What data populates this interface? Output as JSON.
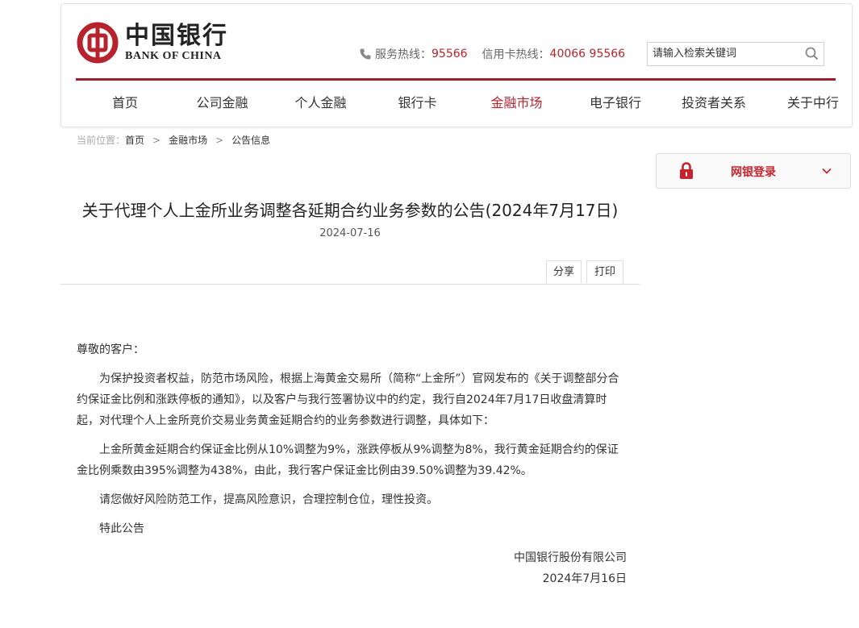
{
  "header": {
    "logo_cn": "中国银行",
    "logo_en": "BANK OF CHINA",
    "service_label": "服务热线：",
    "service_number": "95566",
    "card_label": "信用卡热线：",
    "card_number": "40066 95566",
    "search_placeholder": "请输入检索关键词"
  },
  "nav": {
    "items": [
      {
        "label": "首页"
      },
      {
        "label": "公司金融"
      },
      {
        "label": "个人金融"
      },
      {
        "label": "银行卡"
      },
      {
        "label": "金融市场"
      },
      {
        "label": "电子银行"
      },
      {
        "label": "投资者关系"
      },
      {
        "label": "关于中行"
      }
    ],
    "active": "金融市场"
  },
  "breadcrumb": {
    "lead": "当前位置：",
    "items": [
      "首页",
      "金融市场",
      "公告信息"
    ]
  },
  "login": {
    "label": "网银登录"
  },
  "article": {
    "title": "关于代理个人上金所业务调整各延期合约业务参数的公告(2024年7月17日)",
    "date": "2024-07-16",
    "share_label": "分享",
    "print_label": "打印",
    "greeting": "尊敬的客户：",
    "paragraphs": [
      "为保护投资者权益，防范市场风险，根据上海黄金交易所（简称“上金所”）官网发布的《关于调整部分合约保证金比例和涨跌停板的通知》，以及客户与我行签署协议中的约定，我行自2024年7月17日收盘清算时起，对代理个人上金所竞价交易业务黄金延期合约的业务参数进行调整，具体如下：",
      "上金所黄金延期合约保证金比例从10%调整为9%，涨跌停板从9%调整为8%，我行黄金延期合约的保证金比例乘数由395%调整为438%，由此，我行客户保证金比例由39.50%调整为39.42%。",
      "请您做好风险防范工作，提高风险意识，合理控制仓位，理性投资。",
      "特此公告"
    ],
    "signature": "中国银行股份有限公司",
    "sign_date": "2024年7月16日"
  },
  "colors": {
    "brand_red": "#b7232c",
    "divider_red": "#9c1f2c"
  }
}
